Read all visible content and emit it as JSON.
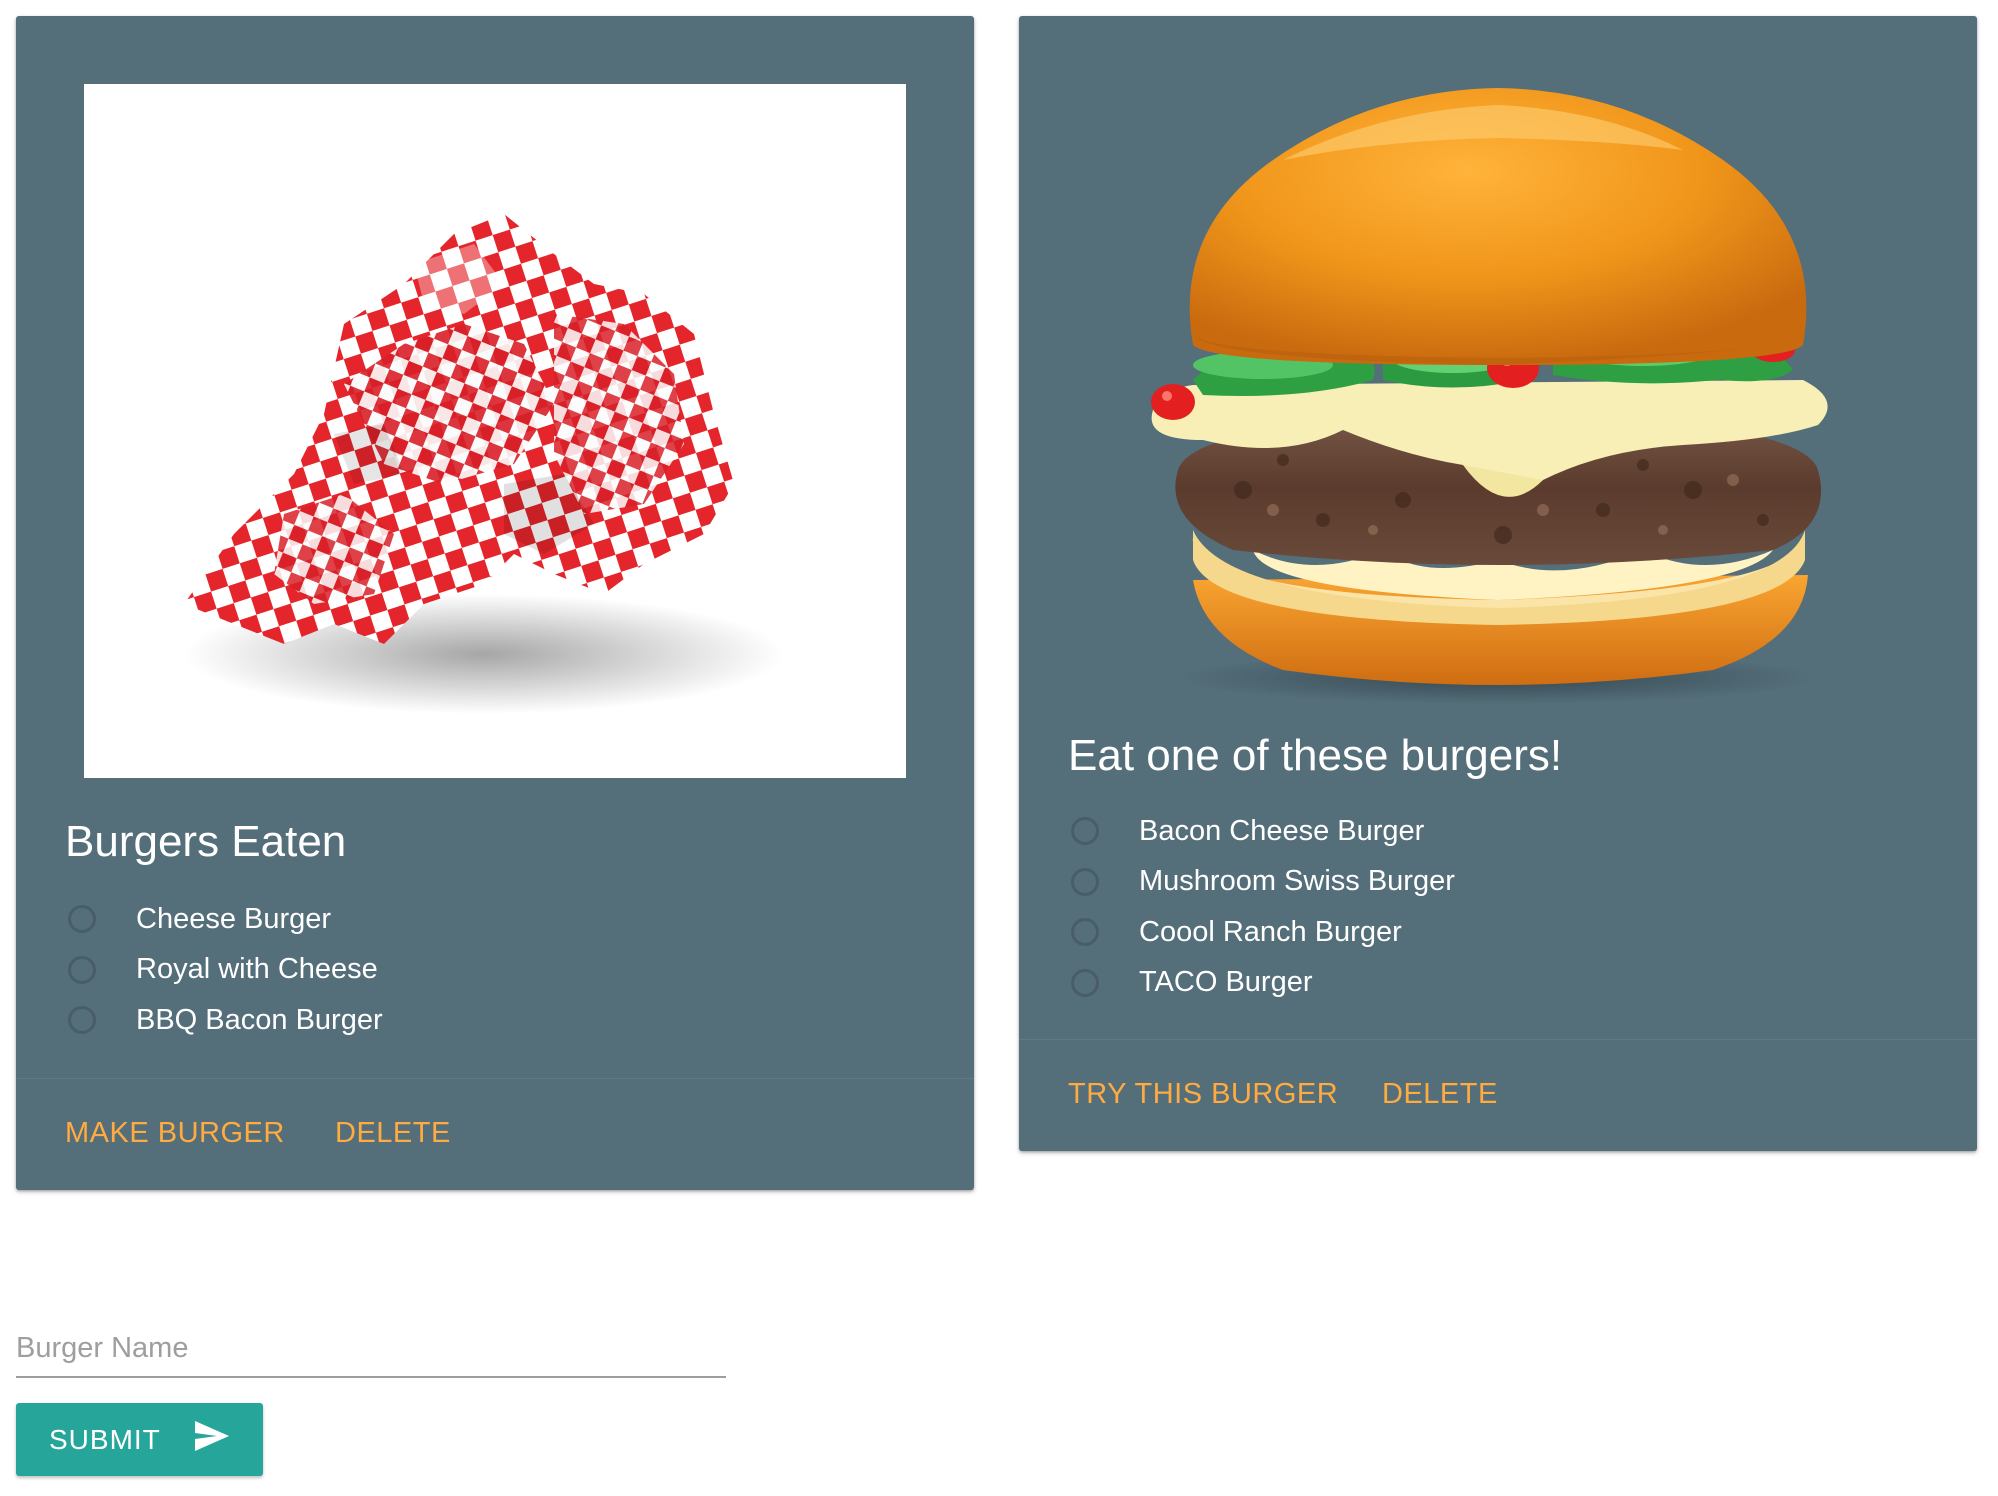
{
  "eaten_card": {
    "title": "Burgers Eaten",
    "image": "crumpled-checkered-paper",
    "items": [
      {
        "label": "Cheese Burger"
      },
      {
        "label": "Royal with Cheese"
      },
      {
        "label": "BBQ Bacon Burger"
      }
    ],
    "actions": {
      "make": "MAKE BURGER",
      "delete": "DELETE"
    }
  },
  "menu_card": {
    "title": "Eat one of these burgers!",
    "image": "cheeseburger",
    "items": [
      {
        "label": "Bacon Cheese Burger"
      },
      {
        "label": "Mushroom Swiss Burger"
      },
      {
        "label": "Coool Ranch Burger"
      },
      {
        "label": "TACO Burger"
      }
    ],
    "actions": {
      "try": "TRY THIS BURGER",
      "delete": "DELETE"
    }
  },
  "form": {
    "placeholder": "Burger Name",
    "value": "",
    "submit_label": "SUBMIT",
    "submit_icon": "send-icon"
  },
  "colors": {
    "card_bg": "#546e7a",
    "action_link": "#ffab40",
    "submit_bg": "#26a69a"
  }
}
